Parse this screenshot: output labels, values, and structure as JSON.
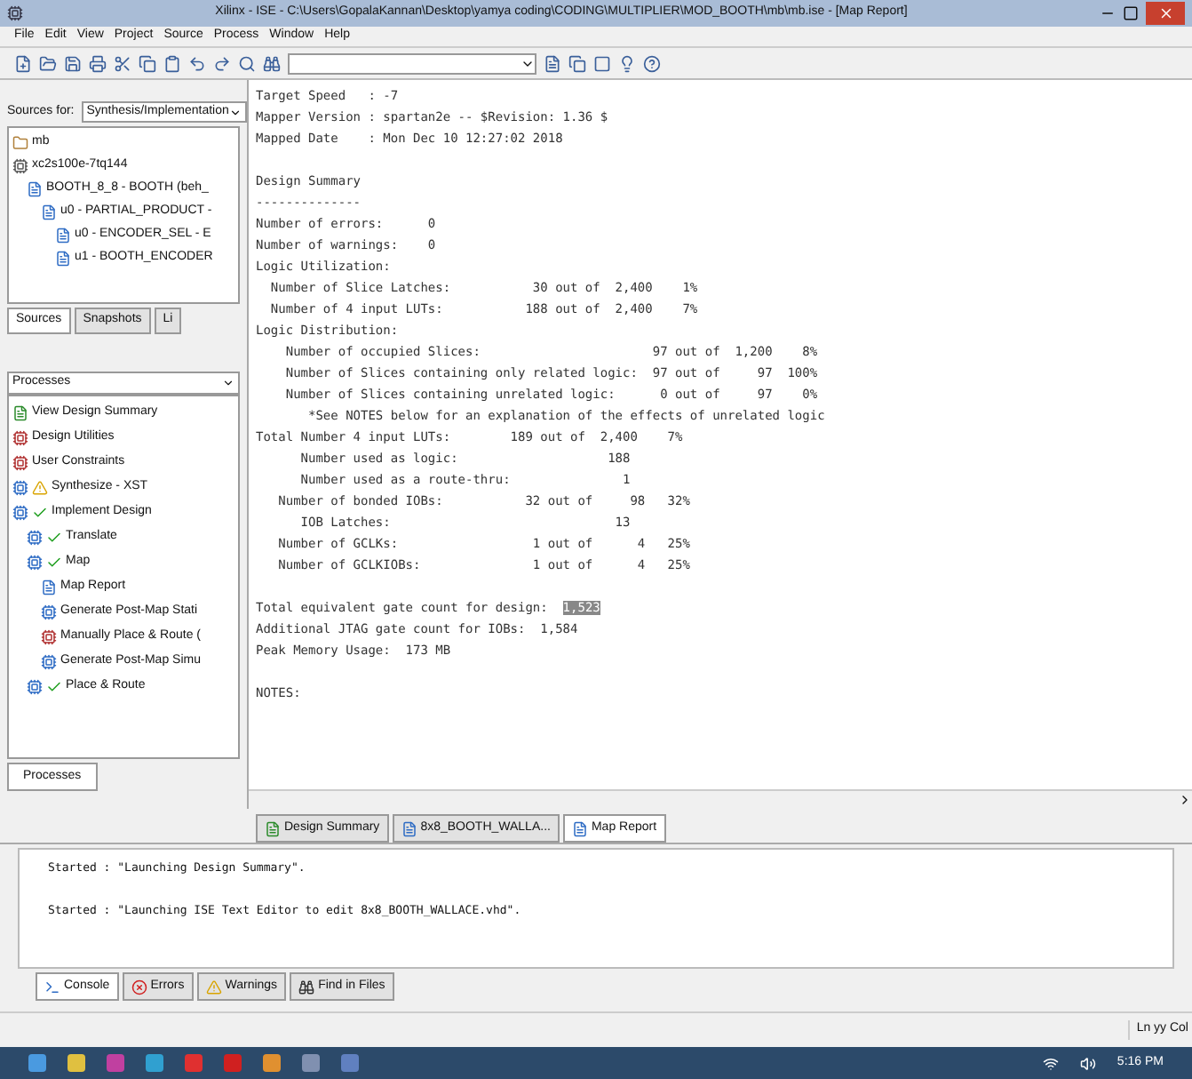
{
  "window": {
    "title": "Xilinx - ISE - C:\\Users\\GopalaKannan\\Desktop\\yamya coding\\CODING\\MULTIPLIER\\MOD_BOOTH\\mb\\mb.ise - [Map Report]"
  },
  "menu": [
    "File",
    "Edit",
    "View",
    "Project",
    "Source",
    "Process",
    "Window",
    "Help"
  ],
  "sources": {
    "label": "Sources for:",
    "select": "Synthesis/Implementation",
    "tree": [
      {
        "label": "mb",
        "kind": "project"
      },
      {
        "label": "xc2s100e-7tq144",
        "kind": "device",
        "children": [
          {
            "label": "BOOTH_8_8 - BOOTH (beh_",
            "kind": "module",
            "children": [
              {
                "label": "u0 - PARTIAL_PRODUCT -",
                "kind": "module",
                "children": [
                  {
                    "label": "u0 - ENCODER_SEL - E",
                    "kind": "module"
                  },
                  {
                    "label": "u1 - BOOTH_ENCODER",
                    "kind": "module"
                  }
                ]
              }
            ]
          }
        ]
      }
    ],
    "tabs": [
      {
        "label": "Sources",
        "selected": true
      },
      {
        "label": "Snapshots",
        "selected": false
      },
      {
        "label": "Li",
        "selected": false
      }
    ]
  },
  "processes": {
    "label": "Processes",
    "tree": [
      {
        "label": "View Design Summary",
        "kind": "summary",
        "done": false,
        "warning": false
      },
      {
        "label": "Design Utilities",
        "kind": "tool",
        "done": false,
        "warning": false
      },
      {
        "label": "User Constraints",
        "kind": "tool",
        "done": false,
        "warning": false
      },
      {
        "label": "Synthesize - XST",
        "kind": "process",
        "done": false,
        "warning": true
      },
      {
        "label": "Implement Design",
        "kind": "process",
        "done": true,
        "warning": false,
        "children": [
          {
            "label": "Translate",
            "kind": "process",
            "done": true,
            "warning": false
          },
          {
            "label": "Map",
            "kind": "process",
            "done": true,
            "warning": false,
            "children": [
              {
                "label": "Map Report",
                "kind": "report",
                "done": false,
                "warning": false
              },
              {
                "label": "Generate Post-Map Stati",
                "kind": "process",
                "done": false,
                "warning": false
              },
              {
                "label": "Manually Place & Route (",
                "kind": "tool",
                "done": false,
                "warning": false
              },
              {
                "label": "Generate Post-Map Simu",
                "kind": "process",
                "done": false,
                "warning": false
              }
            ]
          },
          {
            "label": "Place & Route",
            "kind": "process",
            "done": true,
            "warning": false
          }
        ]
      }
    ],
    "tabs": [
      {
        "label": "Processes",
        "selected": true
      }
    ]
  },
  "report": {
    "blocks": [
      [
        {
          "text": "Target Speed   : -7"
        },
        {
          "text": "Mapper Version : spartan2e -- $Revision: 1.36 $"
        },
        {
          "text": "Mapped Date    : Mon Dec 10 12:27:02 2018"
        }
      ],
      [
        {
          "text": "Design Summary"
        },
        {
          "text": "--------------"
        },
        {
          "text": "Number of errors:      0"
        },
        {
          "text": "Number of warnings:    0"
        },
        {
          "text": "Logic Utilization:"
        },
        {
          "text": "  Number of Slice Latches:           30 out of  2,400    1%"
        },
        {
          "text": "  Number of 4 input LUTs:           188 out of  2,400    7%"
        },
        {
          "text": "Logic Distribution:"
        },
        {
          "text": "    Number of occupied Slices:                       97 out of  1,200    8%"
        },
        {
          "text": "    Number of Slices containing only related logic:  97 out of     97  100%"
        },
        {
          "text": "    Number of Slices containing unrelated logic:      0 out of     97    0%"
        },
        {
          "text": "       *See NOTES below for an explanation of the effects of unrelated logic"
        },
        {
          "text": "Total Number 4 input LUTs:        189 out of  2,400    7%"
        },
        {
          "text": "      Number used as logic:                    188"
        },
        {
          "text": "      Number used as a route-thru:               1"
        },
        {
          "text": "   Number of bonded IOBs:           32 out of     98   32%"
        },
        {
          "text": "      IOB Latches:                              13"
        },
        {
          "text": "   Number of GCLKs:                  1 out of      4   25%"
        },
        {
          "text": "   Number of GCLKIOBs:               1 out of      4   25%"
        }
      ],
      [
        {
          "text": "Total equivalent gate count for design:  ",
          "selected_text": "1,523"
        },
        {
          "text": "Additional JTAG gate count for IOBs:  1,584"
        },
        {
          "text": "Peak Memory Usage:  173 MB"
        }
      ],
      [
        {
          "text": "NOTES:"
        }
      ]
    ]
  },
  "doc_tabs": [
    {
      "label": "Design Summary",
      "kind": "summary",
      "selected": false
    },
    {
      "label": "8x8_BOOTH_WALLA...",
      "kind": "source",
      "selected": false
    },
    {
      "label": "Map Report",
      "kind": "report",
      "selected": true
    }
  ],
  "console": {
    "lines": [
      "Started : \"Launching Design Summary\".",
      "Started : \"Launching ISE Text Editor to edit 8x8_BOOTH_WALLACE.vhd\"."
    ],
    "tabs": [
      {
        "label": "Console",
        "kind": "console",
        "selected": true
      },
      {
        "label": "Errors",
        "kind": "errors",
        "selected": false
      },
      {
        "label": "Warnings",
        "kind": "warnings",
        "selected": false
      },
      {
        "label": "Find in Files",
        "kind": "find",
        "selected": false
      }
    ]
  },
  "status_bar": {
    "position": "Ln yy Col"
  },
  "taskbar": {
    "time": "5:16 PM"
  }
}
